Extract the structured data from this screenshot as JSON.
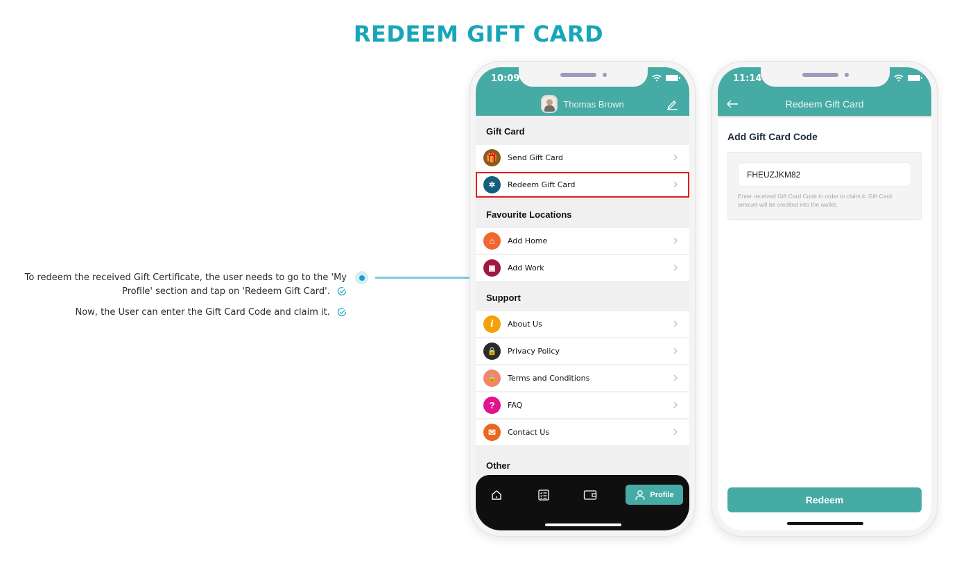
{
  "page": {
    "title": "REDEEM GIFT CARD",
    "accent_color": "#17a6b8",
    "annotations": [
      "To redeem the received Gift Certificate, the user needs to go to the 'My Profile' section and tap on 'Redeem Gift Card'.",
      "Now, the User can enter the Gift Card Code and claim it."
    ]
  },
  "profile_screen": {
    "status_time": "10:09",
    "user_name": "Thomas Brown",
    "header_color": "#46aaa5",
    "sections": [
      {
        "title": "Gift Card",
        "items": [
          {
            "label": "Send Gift Card",
            "icon": "gift-send-icon",
            "color": "#8b5a1e"
          },
          {
            "label": "Redeem Gift Card",
            "icon": "gift-redeem-icon",
            "color": "#135e7f",
            "highlighted": true
          }
        ]
      },
      {
        "title": "Favourite Locations",
        "items": [
          {
            "label": "Add Home",
            "icon": "home-pin-icon",
            "color": "#f2672f"
          },
          {
            "label": "Add Work",
            "icon": "work-pin-icon",
            "color": "#a1183f"
          }
        ]
      },
      {
        "title": "Support",
        "items": [
          {
            "label": "About Us",
            "icon": "info-icon",
            "color": "#f5a006"
          },
          {
            "label": "Privacy Policy",
            "icon": "privacy-lock-icon",
            "color": "#2b2b2b"
          },
          {
            "label": "Terms and Conditions",
            "icon": "lock-icon",
            "color": "#f4846a"
          },
          {
            "label": "FAQ",
            "icon": "question-icon",
            "color": "#e2138e"
          },
          {
            "label": "Contact Us",
            "icon": "mail-icon",
            "color": "#e8681c"
          }
        ]
      },
      {
        "title": "Other",
        "items": []
      }
    ],
    "tabs": {
      "home": "home-icon",
      "trips": "checklist-icon",
      "wallet": "wallet-icon",
      "profile_label": "Profile"
    }
  },
  "redeem_screen": {
    "status_time": "11:14",
    "header_title": "Redeem Gift Card",
    "section_title": "Add Gift Card Code",
    "code_value": "FHEUZJKM82",
    "hint": "Enter received Gift Card Code in order to claim it. Gift Card amount will be credited into the wallet.",
    "button_label": "Redeem"
  }
}
